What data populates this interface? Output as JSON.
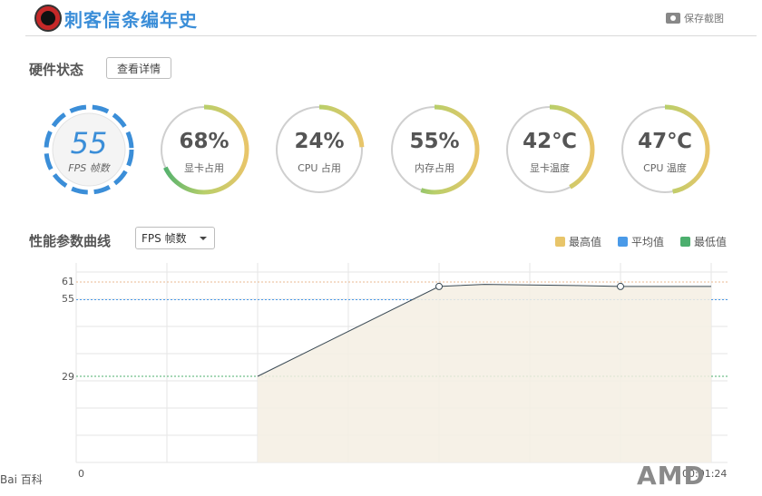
{
  "app": {
    "title": "刺客信条编年史",
    "screenshot_label": "保存截图"
  },
  "hardware": {
    "title": "硬件状态",
    "details_button": "查看详情",
    "fps": {
      "value": "55",
      "label": "FPS 帧数"
    },
    "gauges": [
      {
        "value": "68%",
        "label": "显卡占用",
        "level": 0.68
      },
      {
        "value": "24%",
        "label": "CPU 占用",
        "level": 0.24
      },
      {
        "value": "55%",
        "label": "内存占用",
        "level": 0.55
      },
      {
        "value": "42℃",
        "label": "显卡温度",
        "level": 0.42
      },
      {
        "value": "47℃",
        "label": "CPU 温度",
        "level": 0.47
      }
    ]
  },
  "curve": {
    "title": "性能参数曲线",
    "select_value": "FPS 帧数",
    "legend": [
      {
        "label": "最高值",
        "color": "#e8c56a"
      },
      {
        "label": "平均值",
        "color": "#4a9ae8"
      },
      {
        "label": "最低值",
        "color": "#4caf6e"
      }
    ]
  },
  "chart_data": {
    "type": "line",
    "x_start_label": "0",
    "x_end_label": "00:01:24",
    "yticks": [
      "61",
      "55",
      "29"
    ],
    "max": 61,
    "avg": 55,
    "min": 29,
    "series": [
      {
        "x": [
          0.2,
          0.4,
          0.45,
          0.55,
          0.6,
          0.7
        ],
        "y": [
          29,
          59.5,
          60.2,
          59.8,
          59.5,
          59.5
        ]
      }
    ]
  },
  "watermarks": {
    "baidu": "Bai 百科",
    "amd": "AMD"
  }
}
